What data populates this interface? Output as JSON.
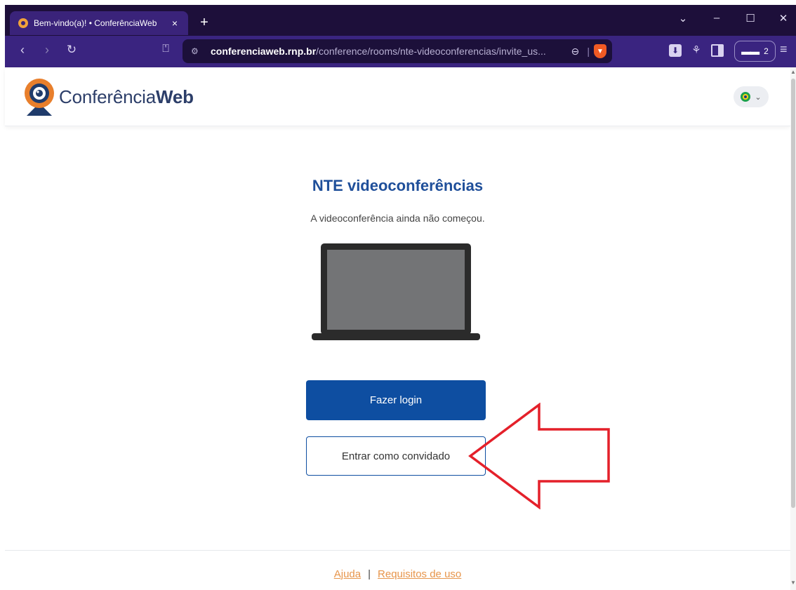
{
  "browser": {
    "tab_title": "Bem-vindo(a)! • ConferênciaWeb",
    "tab_close": "×",
    "new_tab": "+",
    "url_host": "conferenciaweb.rnp.br",
    "url_path": "/conference/rooms/nte-videoconferencias/invite_us...",
    "wallet_count": "2"
  },
  "header": {
    "logo_text_regular": "Conferência",
    "logo_text_bold": "Web"
  },
  "main": {
    "room_title": "NTE videoconferências",
    "status": "A videoconferência ainda não começou.",
    "login_button": "Fazer login",
    "guest_button": "Entrar como convidado"
  },
  "footer": {
    "help_link": "Ajuda",
    "separator": "|",
    "terms_link": "Requisitos de uso"
  },
  "colors": {
    "brand_blue": "#0e4ea1",
    "title_blue": "#1f4f9a",
    "link_orange": "#e7954b",
    "annotation_red": "#e4202a",
    "browser_purple": "#3a2480"
  }
}
